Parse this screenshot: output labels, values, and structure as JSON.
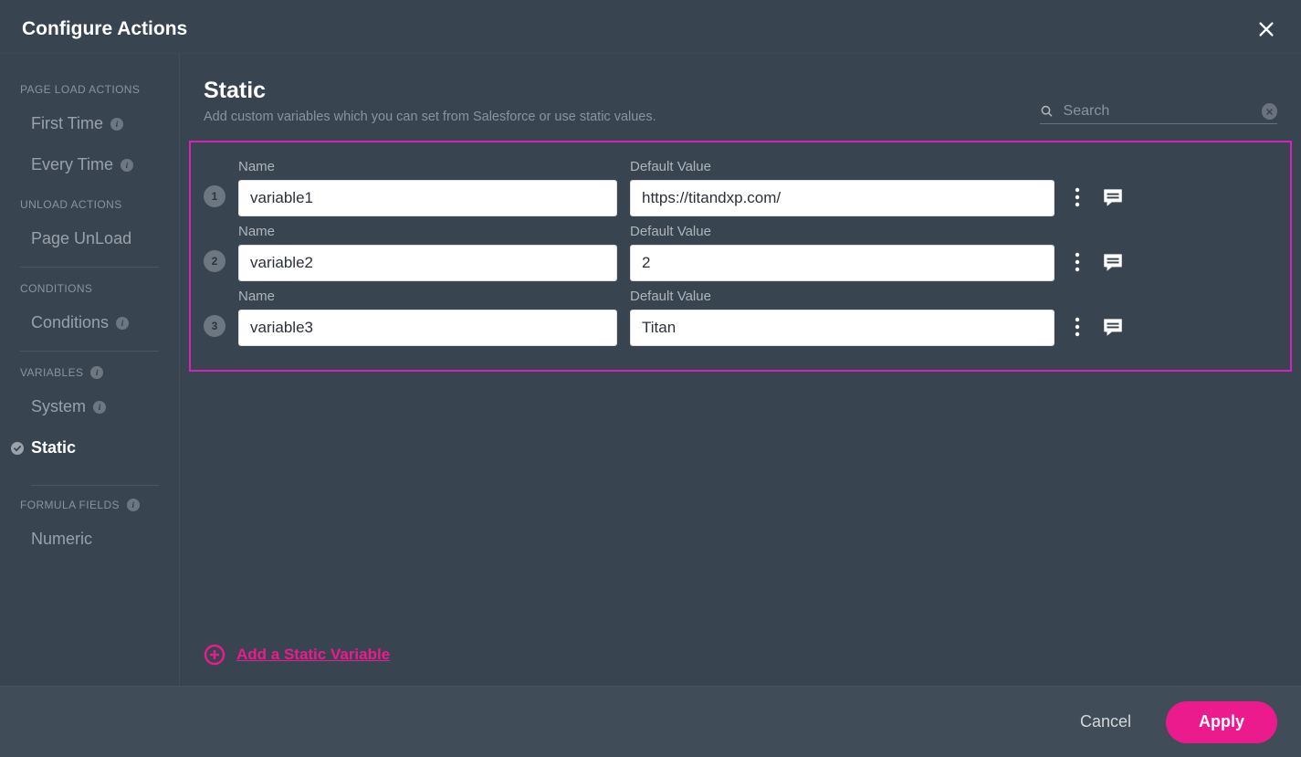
{
  "header": {
    "title": "Configure Actions"
  },
  "sidebar": {
    "sections": {
      "pageLoad": {
        "title": "PAGE LOAD ACTIONS",
        "items": [
          {
            "label": "First Time",
            "info": true
          },
          {
            "label": "Every Time",
            "info": true
          }
        ]
      },
      "unload": {
        "title": "UNLOAD ACTIONS",
        "items": [
          {
            "label": "Page UnLoad"
          }
        ]
      },
      "conditions": {
        "title": "CONDITIONS",
        "items": [
          {
            "label": "Conditions",
            "info": true
          }
        ]
      },
      "variables": {
        "title": "VARIABLES",
        "info": true,
        "items": [
          {
            "label": "System",
            "info": true
          },
          {
            "label": "Static",
            "selected": true
          }
        ]
      },
      "formula": {
        "title": "FORMULA FIELDS",
        "info": true,
        "items": [
          {
            "label": "Numeric"
          }
        ]
      }
    }
  },
  "main": {
    "title": "Static",
    "desc": "Add custom variables which you can set from Salesforce or use static values.",
    "search_placeholder": "Search",
    "name_label": "Name",
    "value_label": "Default Value",
    "rows": [
      {
        "index": "1",
        "name": "variable1",
        "value": "https://titandxp.com/"
      },
      {
        "index": "2",
        "name": "variable2",
        "value": "2"
      },
      {
        "index": "3",
        "name": "variable3",
        "value": "Titan"
      }
    ],
    "add_label": "Add a Static Variable"
  },
  "footer": {
    "cancel": "Cancel",
    "apply": "Apply"
  }
}
